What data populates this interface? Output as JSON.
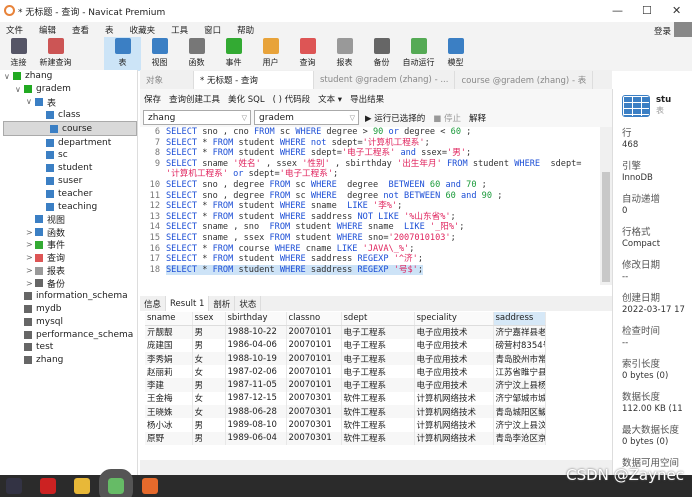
{
  "window": {
    "title": "* 无标题 - 查询 - Navicat Premium",
    "minimize": "—",
    "maximize": "☐",
    "close": "✕"
  },
  "menu": [
    "文件",
    "编辑",
    "查看",
    "表",
    "收藏夹",
    "工具",
    "窗口",
    "帮助"
  ],
  "login": "登录",
  "toolbar": [
    {
      "label": "连接",
      "icon": "connect-icon",
      "color": "#556"
    },
    {
      "label": "新建查询",
      "icon": "new-query-icon",
      "color": "#c55"
    },
    {
      "label": "表",
      "icon": "table-icon",
      "color": "#3b7fc4",
      "active": true
    },
    {
      "label": "视图",
      "icon": "view-icon",
      "color": "#3b7fc4"
    },
    {
      "label": "函数",
      "icon": "function-icon",
      "color": "#777"
    },
    {
      "label": "事件",
      "icon": "event-icon",
      "color": "#3a3"
    },
    {
      "label": "用户",
      "icon": "user-icon",
      "color": "#e8a33a"
    },
    {
      "label": "查询",
      "icon": "query-icon",
      "color": "#d55"
    },
    {
      "label": "报表",
      "icon": "report-icon",
      "color": "#999"
    },
    {
      "label": "备份",
      "icon": "backup-icon",
      "color": "#666"
    },
    {
      "label": "自动运行",
      "icon": "auto-run-icon",
      "color": "#5a5"
    },
    {
      "label": "模型",
      "icon": "model-icon",
      "color": "#3b7fc4"
    }
  ],
  "tree": [
    {
      "label": "zhang",
      "lvl": 0,
      "arrow": "∨",
      "color": "#2a2"
    },
    {
      "label": "gradem",
      "lvl": 1,
      "arrow": "∨",
      "color": "#2a2"
    },
    {
      "label": "表",
      "lvl": 2,
      "arrow": "∨",
      "color": "#3b7fc4"
    },
    {
      "label": "class",
      "lvl": 3,
      "color": "#3b7fc4"
    },
    {
      "label": "course",
      "lvl": 3,
      "color": "#3b7fc4",
      "selected": true
    },
    {
      "label": "department",
      "lvl": 3,
      "color": "#3b7fc4"
    },
    {
      "label": "sc",
      "lvl": 3,
      "color": "#3b7fc4"
    },
    {
      "label": "student",
      "lvl": 3,
      "color": "#3b7fc4"
    },
    {
      "label": "suser",
      "lvl": 3,
      "color": "#3b7fc4"
    },
    {
      "label": "teacher",
      "lvl": 3,
      "color": "#3b7fc4"
    },
    {
      "label": "teaching",
      "lvl": 3,
      "color": "#3b7fc4"
    },
    {
      "label": "视图",
      "lvl": 2,
      "color": "#3b7fc4"
    },
    {
      "label": "函数",
      "lvl": 2,
      "arrow": ">",
      "color": "#3b7fc4"
    },
    {
      "label": "事件",
      "lvl": 2,
      "arrow": ">",
      "color": "#3a3"
    },
    {
      "label": "查询",
      "lvl": 2,
      "arrow": ">",
      "color": "#d55"
    },
    {
      "label": "报表",
      "lvl": 2,
      "arrow": ">",
      "color": "#999"
    },
    {
      "label": "备份",
      "lvl": 2,
      "arrow": ">",
      "color": "#666"
    },
    {
      "label": "information_schema",
      "lvl": 1,
      "color": "#666"
    },
    {
      "label": "mydb",
      "lvl": 1,
      "color": "#666"
    },
    {
      "label": "mysql",
      "lvl": 1,
      "color": "#666"
    },
    {
      "label": "performance_schema",
      "lvl": 1,
      "color": "#666"
    },
    {
      "label": "test",
      "lvl": 1,
      "color": "#666"
    },
    {
      "label": "zhang",
      "lvl": 1,
      "color": "#666"
    }
  ],
  "tabs": [
    {
      "label": "对象"
    },
    {
      "label": "* 无标题 - 查询",
      "active": true
    },
    {
      "label": "student @gradem (zhang) - ..."
    },
    {
      "label": "course @gradem (zhang) - 表"
    }
  ],
  "query_toolbar": [
    "保存",
    "查询创建工具",
    "美化 SQL",
    "( ) 代码段",
    "文本 ▾",
    "导出结果"
  ],
  "connection": "zhang",
  "database": "gradem",
  "run": "▶ 运行已选择的",
  "stop": "■ 停止",
  "explain": "解释",
  "code": [
    {
      "n": "6",
      "t": [
        [
          "k",
          "SELECT"
        ],
        [
          "p",
          " sno , cno "
        ],
        [
          "k",
          "FROM"
        ],
        [
          "p",
          " sc "
        ],
        [
          "k",
          "WHERE"
        ],
        [
          "p",
          " degree > "
        ],
        [
          "n",
          "90"
        ],
        [
          "k",
          " or"
        ],
        [
          "p",
          " degree < "
        ],
        [
          "n",
          "60"
        ],
        [
          "p",
          " ;"
        ]
      ]
    },
    {
      "n": "7",
      "t": [
        [
          "k",
          "SELECT"
        ],
        [
          "p",
          " * "
        ],
        [
          "k",
          "FROM"
        ],
        [
          "p",
          " student "
        ],
        [
          "k",
          "WHERE"
        ],
        [
          "k",
          " not"
        ],
        [
          "p",
          " sdept="
        ],
        [
          "s",
          "'计算机工程系'"
        ],
        [
          "p",
          ";"
        ]
      ]
    },
    {
      "n": "8",
      "t": [
        [
          "k",
          "SELECT"
        ],
        [
          "p",
          " * "
        ],
        [
          "k",
          "FROM"
        ],
        [
          "p",
          " student "
        ],
        [
          "k",
          "WHERE"
        ],
        [
          "p",
          " sdept="
        ],
        [
          "s",
          "'电子工程系'"
        ],
        [
          "k",
          " and"
        ],
        [
          "p",
          " ssex="
        ],
        [
          "s",
          "'男'"
        ],
        [
          "p",
          ";"
        ]
      ]
    },
    {
      "n": "9",
      "t": [
        [
          "k",
          "SELECT"
        ],
        [
          "p",
          " sname "
        ],
        [
          "s",
          "'姓名'"
        ],
        [
          "p",
          " , ssex "
        ],
        [
          "s",
          "'性别'"
        ],
        [
          "p",
          " , sbirthday "
        ],
        [
          "s",
          "'出生年月'"
        ],
        [
          "k",
          " FROM"
        ],
        [
          "p",
          " student "
        ],
        [
          "k",
          "WHERE"
        ],
        [
          "p",
          "  sdept="
        ]
      ]
    },
    {
      "n": "",
      "t": [
        [
          "s",
          "'计算机工程系'"
        ],
        [
          "k",
          " or"
        ],
        [
          "p",
          " sdept="
        ],
        [
          "s",
          "'电子工程系'"
        ],
        [
          "p",
          ";"
        ]
      ]
    },
    {
      "n": "10",
      "t": [
        [
          "k",
          "SELECT"
        ],
        [
          "p",
          " sno , degree "
        ],
        [
          "k",
          "FROM"
        ],
        [
          "p",
          " sc "
        ],
        [
          "k",
          "WHERE"
        ],
        [
          "p",
          "  degree  "
        ],
        [
          "k",
          "BETWEEN"
        ],
        [
          "n",
          " 60"
        ],
        [
          "k",
          " and"
        ],
        [
          "n",
          " 70"
        ],
        [
          "p",
          " ;"
        ]
      ]
    },
    {
      "n": "11",
      "t": [
        [
          "k",
          "SELECT"
        ],
        [
          "p",
          " sno , degree "
        ],
        [
          "k",
          "FROM"
        ],
        [
          "p",
          " sc "
        ],
        [
          "k",
          "WHERE"
        ],
        [
          "p",
          "  degree "
        ],
        [
          "k",
          "not BETWEEN"
        ],
        [
          "n",
          " 60"
        ],
        [
          "k",
          " and"
        ],
        [
          "n",
          " 90"
        ],
        [
          "p",
          " ;"
        ]
      ]
    },
    {
      "n": "12",
      "t": [
        [
          "k",
          "SELECT"
        ],
        [
          "p",
          " * "
        ],
        [
          "k",
          "FROM"
        ],
        [
          "p",
          " student "
        ],
        [
          "k",
          "WHERE"
        ],
        [
          "p",
          " sname  "
        ],
        [
          "k",
          "LIKE"
        ],
        [
          "s",
          " '李%'"
        ],
        [
          "p",
          ";"
        ]
      ]
    },
    {
      "n": "13",
      "t": [
        [
          "k",
          "SELECT"
        ],
        [
          "p",
          " * "
        ],
        [
          "k",
          "FROM"
        ],
        [
          "p",
          " student "
        ],
        [
          "k",
          "WHERE"
        ],
        [
          "p",
          " saddress "
        ],
        [
          "k",
          "NOT LIKE"
        ],
        [
          "s",
          " '%山东省%'"
        ],
        [
          "p",
          ";"
        ]
      ]
    },
    {
      "n": "14",
      "t": [
        [
          "k",
          "SELECT"
        ],
        [
          "p",
          " sname , sno  "
        ],
        [
          "k",
          "FROM"
        ],
        [
          "p",
          " student "
        ],
        [
          "k",
          "WHERE"
        ],
        [
          "p",
          " sname  "
        ],
        [
          "k",
          "LIKE"
        ],
        [
          "s",
          " '_阳%'"
        ],
        [
          "p",
          ";"
        ]
      ]
    },
    {
      "n": "15",
      "t": [
        [
          "k",
          "SELECT"
        ],
        [
          "p",
          " sname , ssex "
        ],
        [
          "k",
          "FROM"
        ],
        [
          "p",
          " student "
        ],
        [
          "k",
          "WHERE"
        ],
        [
          "p",
          " sno="
        ],
        [
          "s",
          "'2007010103'"
        ],
        [
          "p",
          ";"
        ]
      ]
    },
    {
      "n": "16",
      "t": [
        [
          "k",
          "SELECT"
        ],
        [
          "p",
          " * "
        ],
        [
          "k",
          "FROM"
        ],
        [
          "p",
          " course "
        ],
        [
          "k",
          "WHERE"
        ],
        [
          "p",
          " cname "
        ],
        [
          "k",
          "LIKE"
        ],
        [
          "s",
          " 'JAVA\\_%'"
        ],
        [
          "p",
          ";"
        ]
      ]
    },
    {
      "n": "17",
      "t": [
        [
          "k",
          "SELECT"
        ],
        [
          "p",
          " * "
        ],
        [
          "k",
          "FROM"
        ],
        [
          "p",
          " student "
        ],
        [
          "k",
          "WHERE"
        ],
        [
          "p",
          " saddress "
        ],
        [
          "k",
          "REGEXP"
        ],
        [
          "s",
          " '^济'"
        ],
        [
          "p",
          ";"
        ]
      ]
    },
    {
      "n": "18",
      "hl": true,
      "t": [
        [
          "k",
          "SELECT"
        ],
        [
          "p",
          " * "
        ],
        [
          "k",
          "FROM"
        ],
        [
          "p",
          " student "
        ],
        [
          "k",
          "WHERE"
        ],
        [
          "p",
          " saddress "
        ],
        [
          "k",
          "REGEXP"
        ],
        [
          "s",
          " '号$'"
        ],
        [
          "p",
          ";"
        ]
      ]
    }
  ],
  "result_tabs": [
    {
      "label": "信息"
    },
    {
      "label": "Result 1",
      "active": true
    },
    {
      "label": "剖析"
    },
    {
      "label": "状态"
    }
  ],
  "grid": {
    "columns": [
      "sname",
      "ssex",
      "sbirthday",
      "classno",
      "sdept",
      "speciality",
      "saddress"
    ],
    "rows": [
      [
        "亓靓靓",
        "男",
        "1988-10-22",
        "20070101",
        "电子工程系",
        "电子应用技术",
        "济宁嘉祥县老"
      ],
      [
        "庞建国",
        "男",
        "1986-04-06",
        "20070101",
        "电子工程系",
        "电子应用技术",
        "磅营村8354号"
      ],
      [
        "李秀娟",
        "女",
        "1988-10-19",
        "20070101",
        "电子工程系",
        "电子应用技术",
        "青岛胶州市常"
      ],
      [
        "赵丽莉",
        "女",
        "1987-02-06",
        "20070101",
        "电子工程系",
        "电子应用技术",
        "江苏省睢宁县"
      ],
      [
        "李建",
        "男",
        "1987-11-05",
        "20070101",
        "电子工程系",
        "电子应用技术",
        "济宁汶上县杨"
      ],
      [
        "王金梅",
        "女",
        "1987-12-15",
        "20070301",
        "软件工程系",
        "计算机网络技术",
        "济宁邹城市城"
      ],
      [
        "王晓姝",
        "女",
        "1988-06-28",
        "20070301",
        "软件工程系",
        "计算机网络技术",
        "青岛城阳区鲅"
      ],
      [
        "杨小冰",
        "男",
        "1989-08-10",
        "20070301",
        "软件工程系",
        "计算机网络技术",
        "济宁汶上县汶"
      ],
      [
        "原野",
        "男",
        "1989-06-04",
        "20070301",
        "软件工程系",
        "计算机网络技术",
        "青岛李沧区京"
      ]
    ]
  },
  "info": {
    "name": "stu",
    "type": "表",
    "fields": [
      {
        "label": "行",
        "value": "468"
      },
      {
        "label": "引擎",
        "value": "InnoDB"
      },
      {
        "label": "自动递增",
        "value": "0"
      },
      {
        "label": "行格式",
        "value": "Compact"
      },
      {
        "label": "修改日期",
        "value": "--"
      },
      {
        "label": "创建日期",
        "value": "2022-03-17 17"
      },
      {
        "label": "检查时间",
        "value": "--"
      },
      {
        "label": "索引长度",
        "value": "0 bytes (0)"
      },
      {
        "label": "数据长度",
        "value": "112.00 KB (11"
      },
      {
        "label": "最大数据长度",
        "value": "0 bytes (0)"
      },
      {
        "label": "数据可用空间",
        "value": ""
      }
    ]
  },
  "watermark": "CSDN @Zaynec",
  "taskbar": [
    {
      "icon": "app-icon",
      "color": "#334"
    },
    {
      "icon": "wps-icon",
      "color": "#c22"
    },
    {
      "icon": "file-explorer-icon",
      "color": "#e8b838"
    },
    {
      "icon": "navicat-icon",
      "color": "#6b6"
    },
    {
      "icon": "firefox-icon",
      "color": "#e66a2c"
    }
  ]
}
